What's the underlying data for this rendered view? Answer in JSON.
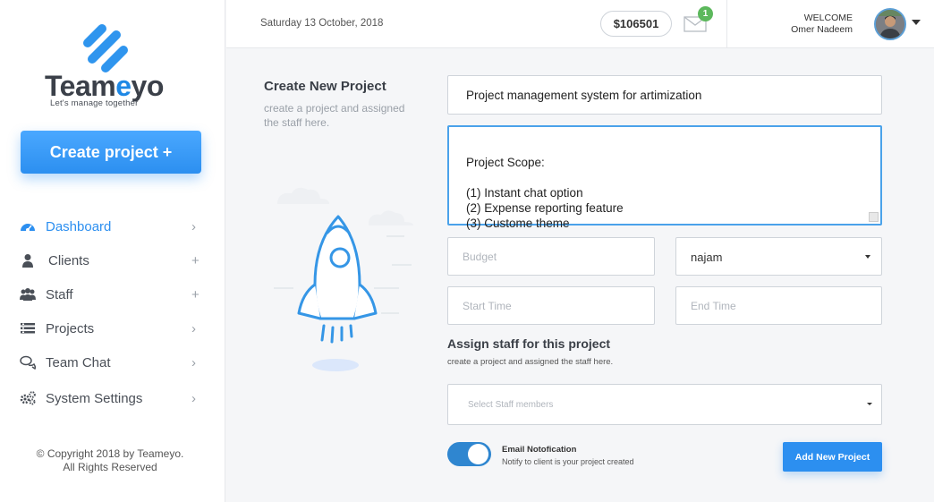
{
  "brand": {
    "name_part1": "Team",
    "name_part2": "e",
    "name_part3": "yo",
    "tagline": "Let's manage together",
    "accent_color": "#2c8ff0"
  },
  "sidebar": {
    "create_button_label": "Create project +",
    "items": [
      {
        "label": "Dashboard",
        "icon": "dashboard-icon",
        "indicator": "›",
        "active": true
      },
      {
        "label": "Clients",
        "icon": "user-icon",
        "indicator": "+",
        "active": false
      },
      {
        "label": "Staff",
        "icon": "users-icon",
        "indicator": "+",
        "active": false
      },
      {
        "label": "Projects",
        "icon": "list-icon",
        "indicator": "›",
        "active": false
      },
      {
        "label": "Team Chat",
        "icon": "chat-icon",
        "indicator": "›",
        "active": false
      },
      {
        "label": "System Settings",
        "icon": "gears-icon",
        "indicator": "›",
        "active": false
      }
    ],
    "copyright_line1": "© Copyright 2018 by Teameyo.",
    "copyright_line2": "All Rights Reserved"
  },
  "header": {
    "date": "Saturday 13 October, 2018",
    "balance": "$106501",
    "mail_count": "1",
    "welcome_label": "WELCOME",
    "user_name": "Omer Nadeem"
  },
  "intro": {
    "title": "Create New Project",
    "subtitle": "create a project and assigned the staff here."
  },
  "form": {
    "project_title": "Project management system for artimization",
    "scope": "Project Scope:\n\n(1) Instant chat option\n(2) Expense reporting feature\n(3) Custome theme",
    "budget_placeholder": "Budget",
    "assignee_value": "najam",
    "start_placeholder": "Start Time",
    "end_placeholder": "End Time",
    "assign_title": "Assign staff for this project",
    "assign_subtitle": "create a project and assigned the staff here.",
    "staff_placeholder": "Select Staff members",
    "email_notification_label": "Email Notofication",
    "email_notification_sub": "Notify to client is your project created",
    "email_notification_on": true,
    "submit_label": "Add New Project"
  }
}
